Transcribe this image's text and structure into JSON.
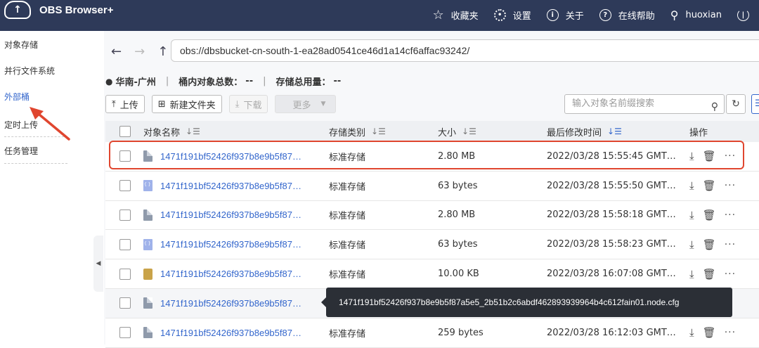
{
  "app": {
    "title": "OBS Browser+",
    "logo_icon": "cloud-upload-icon"
  },
  "topnav": {
    "favorites": "收藏夹",
    "settings": "设置",
    "about": "关于",
    "help": "在线帮助",
    "user": "huoxian"
  },
  "sidebar": {
    "items": [
      {
        "label": "对象存储"
      },
      {
        "label": "并行文件系统"
      },
      {
        "label": "外部桶"
      },
      {
        "label": "定时上传"
      },
      {
        "label": "任务管理"
      }
    ],
    "active_index": 2
  },
  "path": {
    "value": "obs://dbsbucket-cn-south-1-ea28ad0541ce46d1a14cf6affac93242/"
  },
  "info": {
    "region": "华南-广州",
    "object_count_label": "桶内对象总数：",
    "object_count_value": "--",
    "usage_label": "存储总用量：",
    "usage_value": "--"
  },
  "toolbar": {
    "upload": "上传",
    "new_folder": "新建文件夹",
    "download": "下载",
    "more": "更多",
    "search_placeholder": "输入对象名前缀搜索"
  },
  "table": {
    "headers": {
      "name": "对象名称",
      "storage_class": "存储类别",
      "size": "大小",
      "modified": "最后修改时间",
      "ops": "操作"
    },
    "rows": [
      {
        "name": "1471f191bf52426f937b8e9b5f87…",
        "icon": "doc",
        "storage_class": "标准存储",
        "size": "2.80 MB",
        "modified": "2022/03/28 15:55:45 GMT…"
      },
      {
        "name": "1471f191bf52426f937b8e9b5f87…",
        "icon": "cfg",
        "storage_class": "标准存储",
        "size": "63 bytes",
        "modified": "2022/03/28 15:55:50 GMT…"
      },
      {
        "name": "1471f191bf52426f937b8e9b5f87…",
        "icon": "doc",
        "storage_class": "标准存储",
        "size": "2.80 MB",
        "modified": "2022/03/28 15:58:18 GMT…"
      },
      {
        "name": "1471f191bf52426f937b8e9b5f87…",
        "icon": "cfg",
        "storage_class": "标准存储",
        "size": "63 bytes",
        "modified": "2022/03/28 15:58:23 GMT…"
      },
      {
        "name": "1471f191bf52426f937b8e9b5f87…",
        "icon": "zip",
        "storage_class": "标准存储",
        "size": "10.00 KB",
        "modified": "2022/03/28 16:07:08 GMT…"
      },
      {
        "name": "1471f191bf52426f937b8e9b5f87…",
        "icon": "doc",
        "storage_class": "",
        "size": "",
        "modified": ""
      },
      {
        "name": "1471f191bf52426f937b8e9b5f87…",
        "icon": "doc",
        "storage_class": "标准存储",
        "size": "259 bytes",
        "modified": "2022/03/28 16:12:03 GMT…"
      }
    ]
  },
  "tooltip": {
    "text": "1471f191bf52426f937b8e9b5f87a5e5_2b51b2c6abdf462893939964b4c612fain01.node.cfg"
  },
  "colors": {
    "topbar": "#2e3a59",
    "link": "#3366cc",
    "annotation": "#e0462f"
  }
}
